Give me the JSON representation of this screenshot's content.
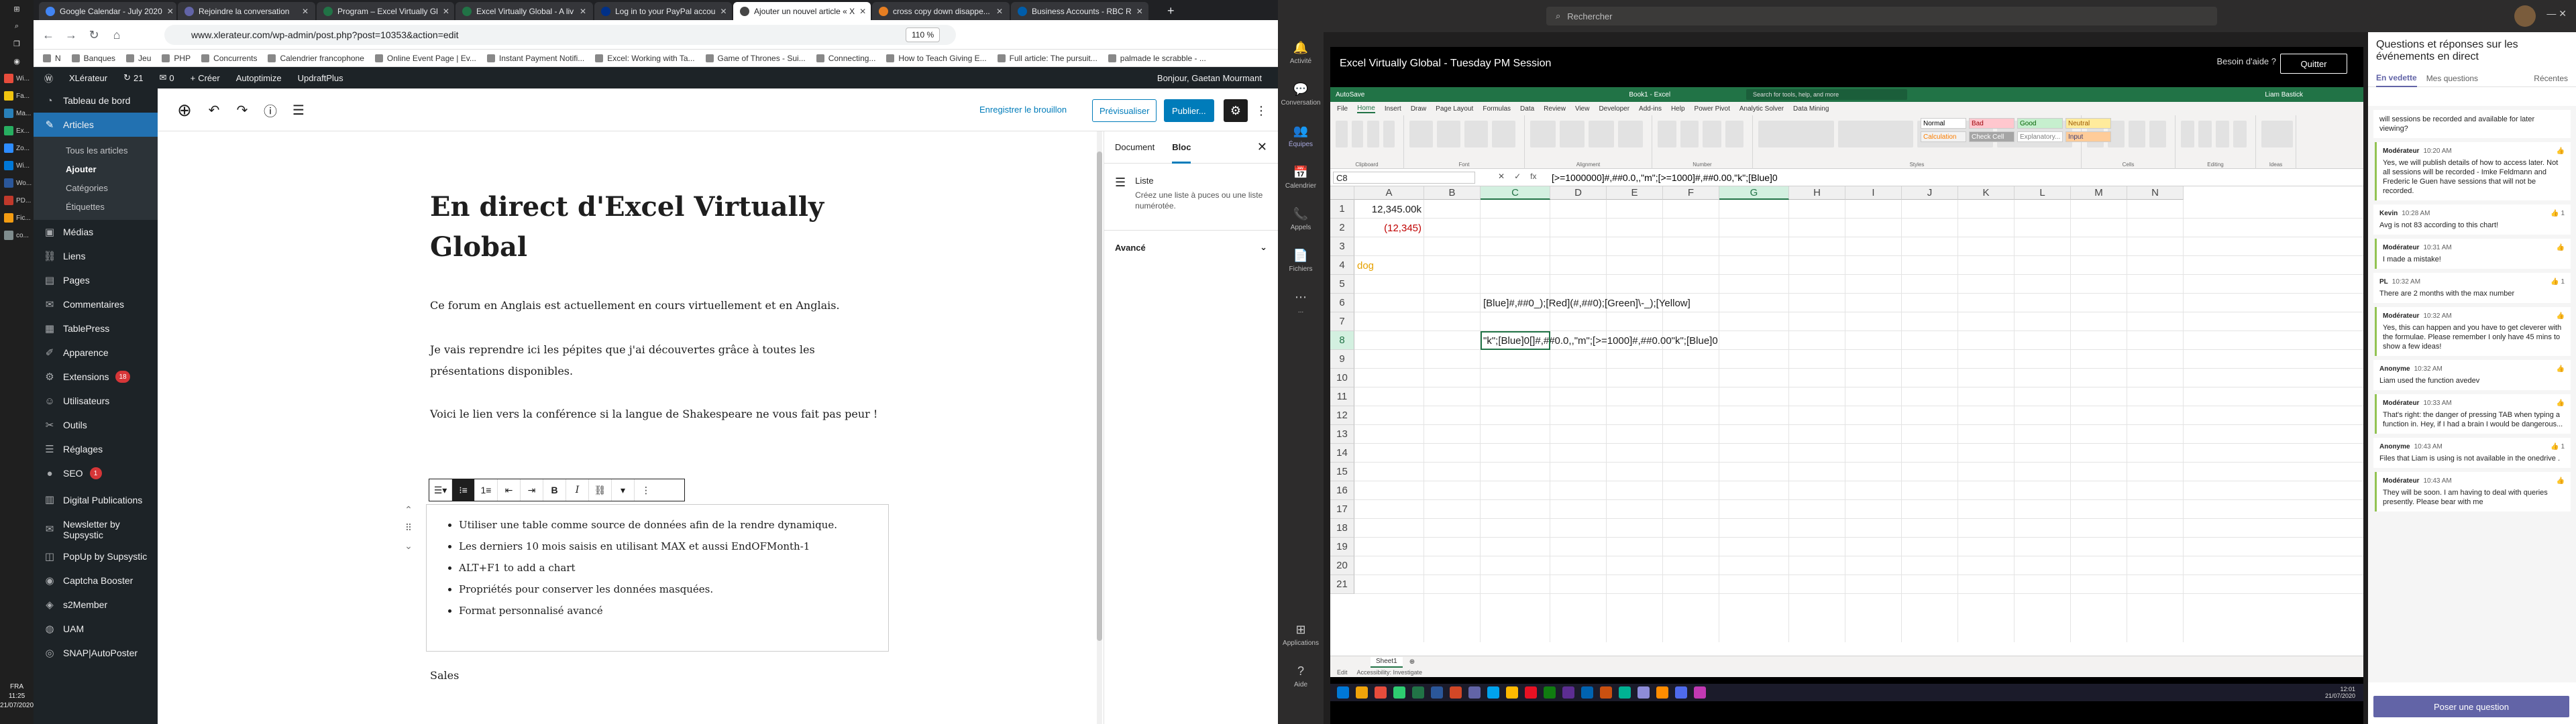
{
  "win_taskbar": {
    "time": "11:25",
    "date": "21/07/2020",
    "lang": "FRA",
    "apps": [
      {
        "label": "Wi...",
        "color": "#e74c3c"
      },
      {
        "label": "Fa...",
        "color": "#f1c40f"
      },
      {
        "label": "Ma...",
        "color": "#2980b9"
      },
      {
        "label": "Ex...",
        "color": "#27ae60"
      },
      {
        "label": "Zo...",
        "color": "#2d8cff"
      },
      {
        "label": "Wi...",
        "color": "#0078d7"
      },
      {
        "label": "Wo...",
        "color": "#2b579a"
      },
      {
        "label": "PD...",
        "color": "#c0392b"
      },
      {
        "label": "Fic...",
        "color": "#f39c12"
      },
      {
        "label": "co...",
        "color": "#7f8c8d"
      }
    ]
  },
  "browser": {
    "tabs": [
      {
        "label": "Google Calendar - July 2020",
        "color": "#4285f4"
      },
      {
        "label": "Rejoindre la conversation",
        "color": "#6264a7"
      },
      {
        "label": "Program – Excel Virtually Gl",
        "color": "#217346"
      },
      {
        "label": "Excel Virtually Global - A liv",
        "color": "#217346"
      },
      {
        "label": "Log in to your PayPal accou",
        "color": "#003087"
      },
      {
        "label": "Ajouter un nouvel article « X",
        "color": "#464646"
      },
      {
        "label": "cross copy down disappe...",
        "color": "#e67e22"
      },
      {
        "label": "Business Accounts - RBC R",
        "color": "#005daa"
      }
    ],
    "url": "www.xlerateur.com/wp-admin/post.php?post=10353&action=edit",
    "zoom": "110 %",
    "bookmarks": [
      "N",
      "Banques",
      "Jeu",
      "PHP",
      "Concurrents",
      "Calendrier francophone",
      "Online Event Page | Ev...",
      "Instant Payment Notifi...",
      "Excel: Working with Ta...",
      "Game of Thrones - Sui...",
      "Connecting...",
      "How to Teach Giving E...",
      "Full article: The pursuit...",
      "palmade le scrabble - ..."
    ]
  },
  "wp": {
    "adminbar": {
      "site": "XLérateur",
      "updates": "21",
      "comments": "0",
      "new": "Créer",
      "plugins": [
        "Autoptimize",
        "UpdraftPlus"
      ],
      "greeting": "Bonjour, Gaetan Mourmant"
    },
    "menu": [
      {
        "label": "Tableau de bord",
        "icon": "dashboard-icon",
        "glyph": "◔"
      },
      {
        "label": "Articles",
        "icon": "pin-icon",
        "glyph": "✎",
        "active": true
      },
      {
        "label": "Médias",
        "icon": "media-icon",
        "glyph": "▣"
      },
      {
        "label": "Liens",
        "icon": "link-icon",
        "glyph": "⛓"
      },
      {
        "label": "Pages",
        "icon": "page-icon",
        "glyph": "▤"
      },
      {
        "label": "Commentaires",
        "icon": "comment-icon",
        "glyph": "✉"
      },
      {
        "label": "TablePress",
        "icon": "table-icon",
        "glyph": "▦"
      },
      {
        "label": "Apparence",
        "icon": "brush-icon",
        "glyph": "✐"
      },
      {
        "label": "Extensions",
        "icon": "plugin-icon",
        "glyph": "⚙",
        "badge": "18"
      },
      {
        "label": "Utilisateurs",
        "icon": "users-icon",
        "glyph": "☺"
      },
      {
        "label": "Outils",
        "icon": "tools-icon",
        "glyph": "✂"
      },
      {
        "label": "Réglages",
        "icon": "settings-icon",
        "glyph": "☰"
      },
      {
        "label": "SEO",
        "icon": "seo-icon",
        "glyph": "●",
        "badge": "1"
      },
      {
        "label": "Digital Publications",
        "icon": "publication-icon",
        "glyph": "▥"
      },
      {
        "label": "Newsletter by Supsystic",
        "icon": "newsletter-icon",
        "glyph": "✉"
      },
      {
        "label": "PopUp by Supsystic",
        "icon": "popup-icon",
        "glyph": "◫"
      },
      {
        "label": "Captcha Booster",
        "icon": "captcha-icon",
        "glyph": "◉"
      },
      {
        "label": "s2Member",
        "icon": "member-icon",
        "glyph": "◈"
      },
      {
        "label": "UAM",
        "icon": "uam-icon",
        "glyph": "◍"
      },
      {
        "label": "SNAP|AutoPoster",
        "icon": "autoposter-icon",
        "glyph": "◎"
      }
    ],
    "submenu": [
      "Tous les articles",
      "Ajouter",
      "Catégories",
      "Étiquettes"
    ],
    "toolbar": {
      "draft": "Enregistrer le brouillon",
      "preview": "Prévisualiser",
      "publish": "Publier..."
    },
    "post": {
      "title": "En direct d'Excel Virtually Global",
      "paragraphs": [
        "Ce forum en Anglais est actuellement en cours virtuellement et en Anglais.",
        "Je vais reprendre ici les pépites que j'ai découvertes grâce à toutes les présentations disponibles.",
        "Voici le lien vers la conférence si la langue de Shakespeare ne vous fait pas peur !"
      ],
      "list": [
        "Utiliser une table comme source de données afin de la rendre dynamique.",
        "Les derniers 10 mois saisis en utilisant MAX et aussi EndOFMonth-1",
        "ALT+F1 to add a chart",
        "Propriétés pour conserver les données masquées.",
        "Format personnalisé avancé"
      ],
      "after": "Sales"
    },
    "inspector": {
      "tab_doc": "Document",
      "tab_block": "Bloc",
      "block_name": "Liste",
      "block_desc": "Créez une liste à puces ou une liste numérotée.",
      "advanced": "Avancé"
    }
  },
  "teams": {
    "search": "Rechercher",
    "rail": [
      {
        "label": "Activité",
        "icon": "bell-icon",
        "glyph": "🔔"
      },
      {
        "label": "Conversation",
        "icon": "chat-icon",
        "glyph": "💬"
      },
      {
        "label": "Équipes",
        "icon": "teams-icon",
        "glyph": "👥",
        "on": true
      },
      {
        "label": "Calendrier",
        "icon": "calendar-icon",
        "glyph": "📅"
      },
      {
        "label": "Appels",
        "icon": "call-icon",
        "glyph": "📞"
      },
      {
        "label": "Fichiers",
        "icon": "files-icon",
        "glyph": "📄"
      },
      {
        "label": "...",
        "icon": "more-icon",
        "glyph": "⋯"
      }
    ],
    "rail_bottom": [
      {
        "label": "Applications",
        "icon": "apps-icon",
        "glyph": "⊞"
      },
      {
        "label": "Aide",
        "icon": "help-icon",
        "glyph": "?"
      }
    ],
    "meeting": {
      "title": "Excel Virtually Global - Tuesday PM Session",
      "help": "Besoin d'aide ?",
      "leave": "Quitter"
    }
  },
  "excel": {
    "title": "Book1 - Excel",
    "search": "Search for tools, help, and more",
    "user": "Liam Bastick",
    "menu": [
      "File",
      "Home",
      "Insert",
      "Draw",
      "Page Layout",
      "Formulas",
      "Data",
      "Review",
      "View",
      "Developer",
      "Add-ins",
      "Help",
      "Power Pivot",
      "Analytic Solver",
      "Data Mining"
    ],
    "active_menu": "Home",
    "ribbon_groups": [
      "Clipboard",
      "Font",
      "Alignment",
      "Number",
      "Styles",
      "Cells",
      "Editing",
      "Ideas"
    ],
    "styles": [
      {
        "label": "Normal",
        "bg": "#ffffff",
        "fg": "#000000"
      },
      {
        "label": "Bad",
        "bg": "#ffc7ce",
        "fg": "#9c0006"
      },
      {
        "label": "Good",
        "bg": "#c6efce",
        "fg": "#006100"
      },
      {
        "label": "Neutral",
        "bg": "#ffeb9c",
        "fg": "#9c5700"
      },
      {
        "label": "Calculation",
        "bg": "#f2f2f2",
        "fg": "#fa7d00"
      },
      {
        "label": "Check Cell",
        "bg": "#a5a5a5",
        "fg": "#ffffff"
      },
      {
        "label": "Explanatory...",
        "bg": "#ffffff",
        "fg": "#7f7f7f"
      },
      {
        "label": "Input",
        "bg": "#ffcc99",
        "fg": "#3f3f76"
      }
    ],
    "namebox": "C8",
    "formula": "[>=1000000]#,##0.0,,\"m\";[>=1000]#,##0.00,\"k\";[Blue]0",
    "columns": [
      "A",
      "B",
      "C",
      "D",
      "E",
      "F",
      "G",
      "H",
      "I",
      "J",
      "K",
      "L",
      "M",
      "N"
    ],
    "rows": [
      "1",
      "2",
      "3",
      "4",
      "5",
      "6",
      "7",
      "8",
      "9",
      "10",
      "11",
      "12",
      "13",
      "14",
      "15",
      "16",
      "17",
      "18",
      "19",
      "20",
      "21"
    ],
    "cells": {
      "a1": "12,345.00k",
      "a2": "(12,345)",
      "a4": "dog",
      "c6": "[Blue]#,##0_);[Red](#,##0);[Green]\\-_);[Yellow]",
      "c8": "\"k\";[Blue]0[]#,##0.0,,\"m\";[>=1000]#,##0.00\"k\";[Blue]0"
    },
    "sheet": "Sheet1",
    "status": [
      "Edit",
      "Accessibility: Investigate"
    ],
    "remote_time": "12:01",
    "remote_date": "21/07/2020"
  },
  "qa": {
    "title": "Questions et réponses sur les événements en direct",
    "tabs": [
      "En vedette",
      "Mes questions",
      "Récentes"
    ],
    "items": [
      {
        "type": "q",
        "text": "will sessions be recorded and available for later viewing?"
      },
      {
        "type": "r",
        "author": "Modérateur",
        "time": "10:20 AM",
        "text": "Yes, we will publish details of how to access later. Not all sessions will be recorded - Imke Feldmann and Frederic le Guen have sessions that will not be recorded."
      },
      {
        "type": "q",
        "author": "Kevin",
        "time": "10:28 AM",
        "like": "1",
        "text": "Avg is not 83 according to this chart!"
      },
      {
        "type": "r",
        "author": "Modérateur",
        "time": "10:31 AM",
        "text": "I made a mistake!"
      },
      {
        "type": "q",
        "author": "PL",
        "time": "10:32 AM",
        "like": "1",
        "text": "There are 2 months with the max number"
      },
      {
        "type": "r",
        "author": "Modérateur",
        "time": "10:32 AM",
        "text": "Yes, this can happen and you have to get cleverer with the formulae. Please remember I only have 45 mins to show a few ideas!"
      },
      {
        "type": "q",
        "author": "Anonyme",
        "time": "10:32 AM",
        "text": "Liam used the function avedev"
      },
      {
        "type": "r",
        "author": "Modérateur",
        "time": "10:33 AM",
        "text": "That's right: the danger of pressing TAB when typing a function in. Hey, if I had a brain I would be dangerous..."
      },
      {
        "type": "q",
        "author": "Anonyme",
        "time": "10:43 AM",
        "like": "1",
        "text": "Files that Liam is using is not available in the onedrive ."
      },
      {
        "type": "r",
        "author": "Modérateur",
        "time": "10:43 AM",
        "text": "They will be soon. I am having to deal with queries presently. Please bear with me"
      }
    ],
    "ask": "Poser une question"
  }
}
